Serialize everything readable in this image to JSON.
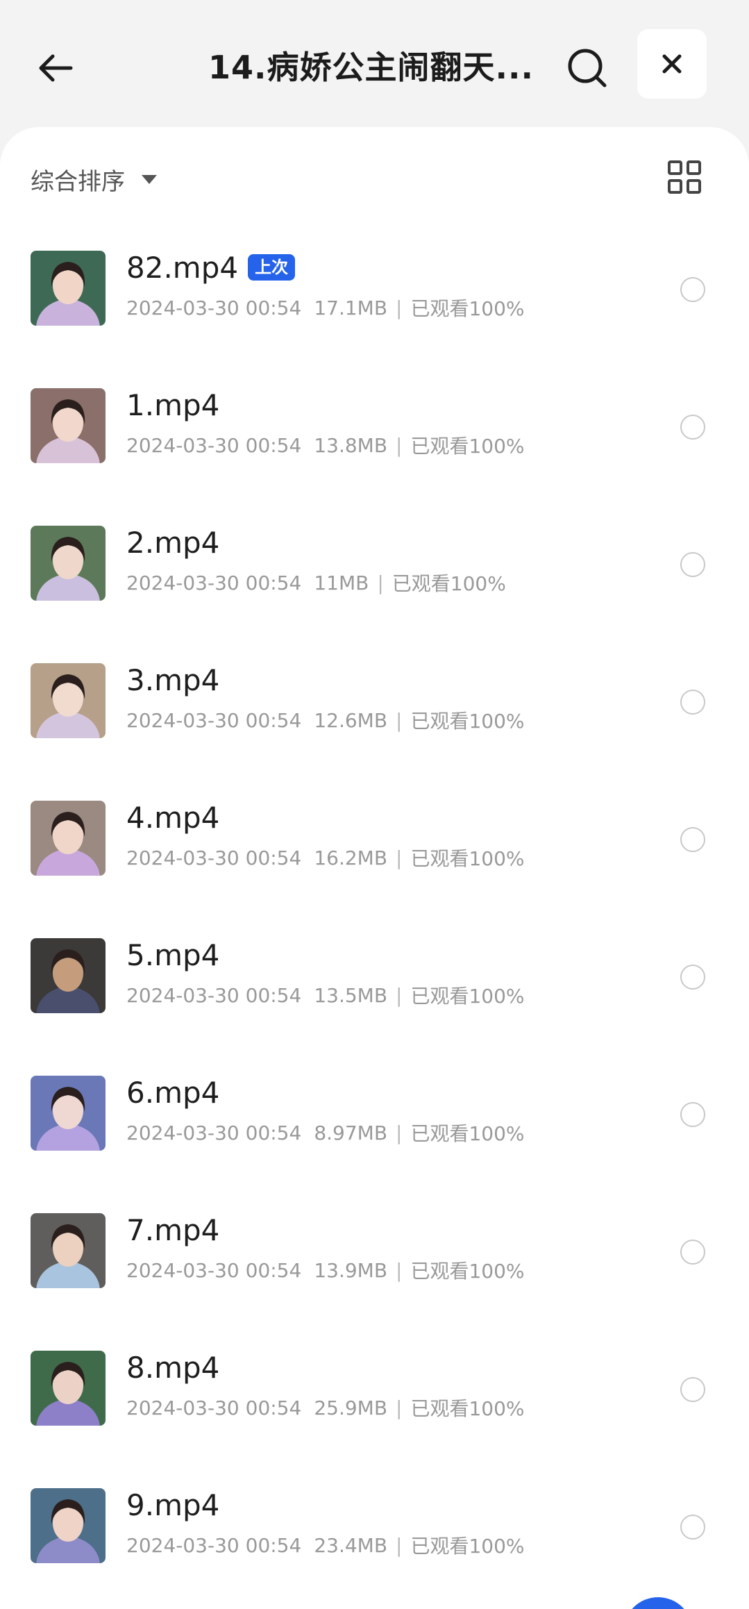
{
  "header": {
    "title": "14.病娇公主闹翻天...",
    "back_icon": "arrow-left-icon",
    "search_icon": "search-icon",
    "close_icon": "close-icon"
  },
  "toolbar": {
    "sort_label": "综合排序",
    "sort_icon": "caret-down-icon",
    "view_icon": "grid-view-icon"
  },
  "colors": {
    "accent": "#2563eb",
    "background": "#f3f3f3",
    "card": "#ffffff"
  },
  "files": [
    {
      "name": "82.mp4",
      "badge": "上次",
      "date": "2024-03-30 00:54",
      "size": "17.1MB",
      "progress": "已观看100%",
      "thumb": [
        "#3e6a55",
        "#c9b3dc",
        "#f1d6c8"
      ]
    },
    {
      "name": "1.mp4",
      "badge": "",
      "date": "2024-03-30 00:54",
      "size": "13.8MB",
      "progress": "已观看100%",
      "thumb": [
        "#8a6f6a",
        "#d8c2d8",
        "#f2d8cc"
      ]
    },
    {
      "name": "2.mp4",
      "badge": "",
      "date": "2024-03-30 00:54",
      "size": "11MB",
      "progress": "已观看100%",
      "thumb": [
        "#5c7a5a",
        "#cbbfe0",
        "#f0d7cb"
      ]
    },
    {
      "name": "3.mp4",
      "badge": "",
      "date": "2024-03-30 00:54",
      "size": "12.6MB",
      "progress": "已观看100%",
      "thumb": [
        "#b6a08a",
        "#d4c5df",
        "#f1dbcf"
      ]
    },
    {
      "name": "4.mp4",
      "badge": "",
      "date": "2024-03-30 00:54",
      "size": "16.2MB",
      "progress": "已观看100%",
      "thumb": [
        "#9b8a82",
        "#c8a8dc",
        "#f0d6c9"
      ]
    },
    {
      "name": "5.mp4",
      "badge": "",
      "date": "2024-03-30 00:54",
      "size": "13.5MB",
      "progress": "已观看100%",
      "thumb": [
        "#3b3a38",
        "#4a4f6e",
        "#c59d7d"
      ]
    },
    {
      "name": "6.mp4",
      "badge": "",
      "date": "2024-03-30 00:54",
      "size": "8.97MB",
      "progress": "已观看100%",
      "thumb": [
        "#6a78b8",
        "#b4a2e0",
        "#f0d8d2"
      ]
    },
    {
      "name": "7.mp4",
      "badge": "",
      "date": "2024-03-30 00:54",
      "size": "13.9MB",
      "progress": "已观看100%",
      "thumb": [
        "#5f5e5c",
        "#a9c4de",
        "#ecd0c0"
      ]
    },
    {
      "name": "8.mp4",
      "badge": "",
      "date": "2024-03-30 00:54",
      "size": "25.9MB",
      "progress": "已观看100%",
      "thumb": [
        "#3f6b4a",
        "#8d80c8",
        "#ecd2c6"
      ]
    },
    {
      "name": "9.mp4",
      "badge": "",
      "date": "2024-03-30 00:54",
      "size": "23.4MB",
      "progress": "已观看100%",
      "thumb": [
        "#4d6f8a",
        "#8e8cc8",
        "#efd3c7"
      ]
    }
  ]
}
